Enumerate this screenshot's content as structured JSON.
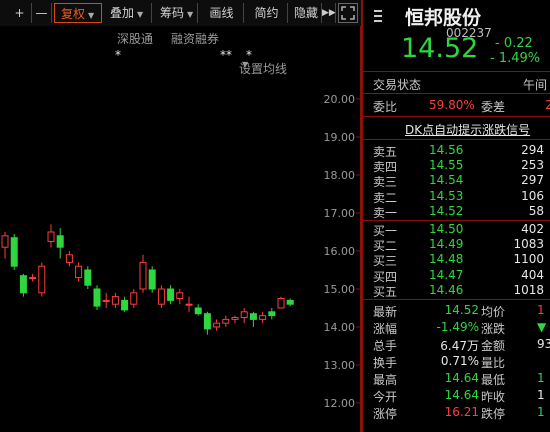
{
  "toolbar": {
    "items": [
      {
        "label": "+"
      },
      {
        "label": "—"
      },
      {
        "label": "复权",
        "dropdown": true
      },
      {
        "label": "叠加",
        "dropdown": true
      },
      {
        "label": "筹码",
        "dropdown": true
      },
      {
        "label": "画线"
      },
      {
        "label": "简约"
      },
      {
        "label": "隐藏"
      }
    ],
    "more": "▶▶",
    "fullscreen_icon": "fullscreen-icon"
  },
  "subbar": {
    "items": [
      "深股通",
      "融资融券",
      "设置均线"
    ]
  },
  "stars": [
    "*",
    "**",
    "*"
  ],
  "colors": {
    "up": "#ff3c3c",
    "down": "#2fd63f",
    "bg": "#000000",
    "axis": "#8a1010"
  },
  "chart_data": {
    "type": "candlestick",
    "ylim": [
      11.7,
      20.7
    ],
    "y_ticks": [
      "20.00",
      "19.00",
      "18.00",
      "17.00",
      "16.00",
      "15.00",
      "14.00",
      "13.00",
      "12.00"
    ],
    "candles": [
      {
        "o": 16.1,
        "c": 16.4,
        "h": 16.5,
        "l": 15.8
      },
      {
        "o": 16.35,
        "c": 15.6,
        "h": 16.45,
        "l": 15.5
      },
      {
        "o": 15.35,
        "c": 14.9,
        "h": 15.4,
        "l": 14.8
      },
      {
        "o": 15.3,
        "c": 15.3,
        "h": 15.4,
        "l": 15.2
      },
      {
        "o": 14.9,
        "c": 15.6,
        "h": 15.7,
        "l": 14.8
      },
      {
        "o": 16.25,
        "c": 16.5,
        "h": 16.7,
        "l": 16.1
      },
      {
        "o": 16.4,
        "c": 16.1,
        "h": 16.6,
        "l": 15.8
      },
      {
        "o": 15.7,
        "c": 15.9,
        "h": 16.0,
        "l": 15.6
      },
      {
        "o": 15.3,
        "c": 15.6,
        "h": 15.7,
        "l": 15.2
      },
      {
        "o": 15.5,
        "c": 15.1,
        "h": 15.6,
        "l": 15.0
      },
      {
        "o": 15.0,
        "c": 14.55,
        "h": 15.1,
        "l": 14.45
      },
      {
        "o": 14.7,
        "c": 14.7,
        "h": 14.9,
        "l": 14.5
      },
      {
        "o": 14.6,
        "c": 14.8,
        "h": 14.9,
        "l": 14.5
      },
      {
        "o": 14.7,
        "c": 14.45,
        "h": 14.8,
        "l": 14.4
      },
      {
        "o": 14.6,
        "c": 14.9,
        "h": 15.0,
        "l": 14.5
      },
      {
        "o": 15.0,
        "c": 15.7,
        "h": 15.9,
        "l": 14.9
      },
      {
        "o": 15.5,
        "c": 15.0,
        "h": 15.6,
        "l": 14.9
      },
      {
        "o": 14.6,
        "c": 15.0,
        "h": 15.1,
        "l": 14.5
      },
      {
        "o": 15.0,
        "c": 14.7,
        "h": 15.1,
        "l": 14.6
      },
      {
        "o": 14.75,
        "c": 14.9,
        "h": 15.0,
        "l": 14.6
      },
      {
        "o": 14.6,
        "c": 14.6,
        "h": 14.8,
        "l": 14.4
      },
      {
        "o": 14.5,
        "c": 14.35,
        "h": 14.6,
        "l": 14.3
      },
      {
        "o": 14.35,
        "c": 13.95,
        "h": 14.4,
        "l": 13.8
      },
      {
        "o": 14.0,
        "c": 14.1,
        "h": 14.2,
        "l": 13.9
      },
      {
        "o": 14.1,
        "c": 14.2,
        "h": 14.3,
        "l": 14.0
      },
      {
        "o": 14.2,
        "c": 14.25,
        "h": 14.3,
        "l": 14.1
      },
      {
        "o": 14.25,
        "c": 14.4,
        "h": 14.5,
        "l": 14.1
      },
      {
        "o": 14.35,
        "c": 14.2,
        "h": 14.4,
        "l": 14.0
      },
      {
        "o": 14.2,
        "c": 14.3,
        "h": 14.4,
        "l": 14.1
      },
      {
        "o": 14.4,
        "c": 14.3,
        "h": 14.5,
        "l": 14.2
      },
      {
        "o": 14.5,
        "c": 14.75,
        "h": 14.8,
        "l": 14.5
      },
      {
        "o": 14.7,
        "c": 14.6,
        "h": 14.75,
        "l": 14.55
      }
    ]
  },
  "quote": {
    "name": "恒邦股份",
    "code": "002237",
    "price": "14.52",
    "change": "- 0.22",
    "change_pct": "- 1.49%",
    "status_label": "交易状态",
    "status_value": "午间",
    "weibi_label": "委比",
    "weibi_value": "59.80%",
    "weicha_label": "委差",
    "weicha_value": "2",
    "dk_text": "DK点自动提示涨跌信号"
  },
  "orderbook": {
    "asks": [
      {
        "label": "卖五",
        "price": "14.56",
        "vol": "294"
      },
      {
        "label": "卖四",
        "price": "14.55",
        "vol": "253"
      },
      {
        "label": "卖三",
        "price": "14.54",
        "vol": "297"
      },
      {
        "label": "卖二",
        "price": "14.53",
        "vol": "106"
      },
      {
        "label": "卖一",
        "price": "14.52",
        "vol": "58"
      }
    ],
    "bids": [
      {
        "label": "买一",
        "price": "14.50",
        "vol": "402"
      },
      {
        "label": "买二",
        "price": "14.49",
        "vol": "1083"
      },
      {
        "label": "买三",
        "price": "14.48",
        "vol": "1100"
      },
      {
        "label": "买四",
        "price": "14.47",
        "vol": "404"
      },
      {
        "label": "买五",
        "price": "14.46",
        "vol": "1018"
      }
    ]
  },
  "stats": [
    {
      "l1": "最新",
      "v1": "14.52",
      "c1": "green",
      "l2": "均价",
      "v2": "1",
      "c2": "red"
    },
    {
      "l1": "涨幅",
      "v1": "-1.49%",
      "c1": "green",
      "l2": "涨跌",
      "v2": "▼",
      "c2": "green"
    },
    {
      "l1": "总手",
      "v1": "6.47万",
      "c1": "white",
      "l2": "金额",
      "v2": "93",
      "c2": "white"
    },
    {
      "l1": "换手",
      "v1": "0.71%",
      "c1": "white",
      "l2": "量比",
      "v2": "",
      "c2": "white"
    },
    {
      "l1": "最高",
      "v1": "14.64",
      "c1": "green",
      "l2": "最低",
      "v2": "1",
      "c2": "green"
    },
    {
      "l1": "今开",
      "v1": "14.64",
      "c1": "green",
      "l2": "昨收",
      "v2": "1",
      "c2": "white"
    },
    {
      "l1": "涨停",
      "v1": "16.21",
      "c1": "red",
      "l2": "跌停",
      "v2": "1",
      "c2": "green"
    }
  ]
}
